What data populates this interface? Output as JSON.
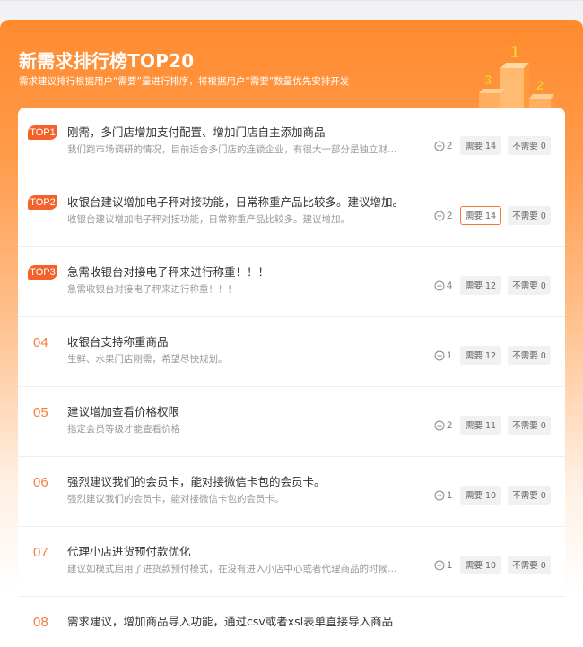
{
  "header": {
    "title": "新需求排行榜TOP20",
    "subtitle": "需求建议排行根据用户“需要”量进行排序，将根据用户“需要”数量优先安排开发",
    "podium": {
      "first": "1",
      "second": "2",
      "third": "3"
    }
  },
  "items": [
    {
      "rank": "TOP1",
      "title": "刚需，多门店增加支付配置、增加门店自主添加商品",
      "desc": "我们跑市场调研的情况，目前适合多门店的连锁企业，有很大一部分是独立财务核算，每个门店的收款账户都是独立的",
      "comments": "2",
      "need": "需要 14",
      "noneed": "不需要 0"
    },
    {
      "rank": "TOP2",
      "title": "收银台建议增加电子秤对接功能，日常称重产品比较多。建议增加。",
      "desc": "收银台建议增加电子秤对接功能，日常称重产品比较多。建议增加。",
      "comments": "2",
      "need": "需要 14",
      "noneed": "不需要 0"
    },
    {
      "rank": "TOP3",
      "title": "急需收银台对接电子秤来进行称重！！！",
      "desc": "急需收银台对接电子秤来进行称重！！！",
      "comments": "4",
      "need": "需要 12",
      "noneed": "不需要 0"
    },
    {
      "rank": "04",
      "title": "收银台支持称重商品",
      "desc": "生鲜、水果门店刚需，希望尽快规划。",
      "comments": "1",
      "need": "需要 12",
      "noneed": "不需要 0"
    },
    {
      "rank": "05",
      "title": "建议增加查看价格权限",
      "desc": "指定会员等级才能查看价格",
      "comments": "2",
      "need": "需要 11",
      "noneed": "不需要 0"
    },
    {
      "rank": "06",
      "title": "强烈建议我们的会员卡，能对接微信卡包的会员卡。",
      "desc": "强烈建议我们的会员卡，能对接微信卡包的会员卡。",
      "comments": "1",
      "need": "需要 10",
      "noneed": "不需要 0"
    },
    {
      "rank": "07",
      "title": "代理小店进货预付款优化",
      "desc": "建议如模式启用了进货款预付模式，在没有进入小店中心或者代理商品的时候就需要预付",
      "comments": "1",
      "need": "需要 10",
      "noneed": "不需要 0"
    },
    {
      "rank": "08",
      "title": "需求建议，增加商品导入功能，通过csv或者xsl表单直接导入商品",
      "desc": "",
      "comments": "",
      "need": "",
      "noneed": ""
    }
  ],
  "colors": {
    "accent": "#ff8a2e",
    "badge": "#f2622a",
    "rank_number": "#f57e3a",
    "active_border": "#f0763a"
  },
  "icons": {
    "comment": "comment-bubble-icon",
    "podium": "trophy-podium-icon"
  }
}
